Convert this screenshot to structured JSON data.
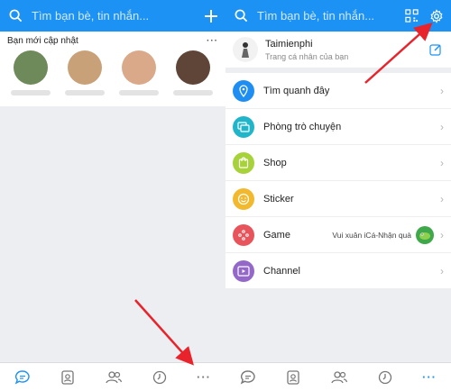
{
  "left": {
    "search_placeholder": "Tìm bạn bè, tin nhắn...",
    "updates_title": "Bạn mới cập nhật",
    "updates_more": "···",
    "avatars": [
      {
        "color": "#6f8a5a"
      },
      {
        "color": "#c9a178"
      },
      {
        "color": "#d9a98a"
      },
      {
        "color": "#5f4438"
      },
      {
        "color": "#e8e8e8"
      }
    ],
    "bottom_more": "···"
  },
  "right": {
    "search_placeholder": "Tìm bạn bè, tin nhắn...",
    "profile": {
      "name": "Taimienphi",
      "subtitle": "Trang cá nhân của bạn"
    },
    "menu": [
      {
        "label": "Tìm quanh đây",
        "color": "#1e8ef3",
        "icon": "location-pin-icon"
      },
      {
        "label": "Phòng trò chuyện",
        "color": "#21b5c9",
        "icon": "chat-room-icon"
      },
      {
        "label": "Shop",
        "color": "#a8d23a",
        "icon": "shop-bag-icon"
      },
      {
        "label": "Sticker",
        "color": "#f2b92e",
        "icon": "smiley-icon"
      },
      {
        "label": "Game",
        "color": "#e8545c",
        "icon": "gamepad-icon",
        "extra": "Vui xuân iCá-Nhận quà"
      },
      {
        "label": "Channel",
        "color": "#9468c9",
        "icon": "video-channel-icon"
      }
    ],
    "bottom_more": "···"
  },
  "colors": {
    "accent": "#1b92f4",
    "arrow": "#e8232b"
  }
}
